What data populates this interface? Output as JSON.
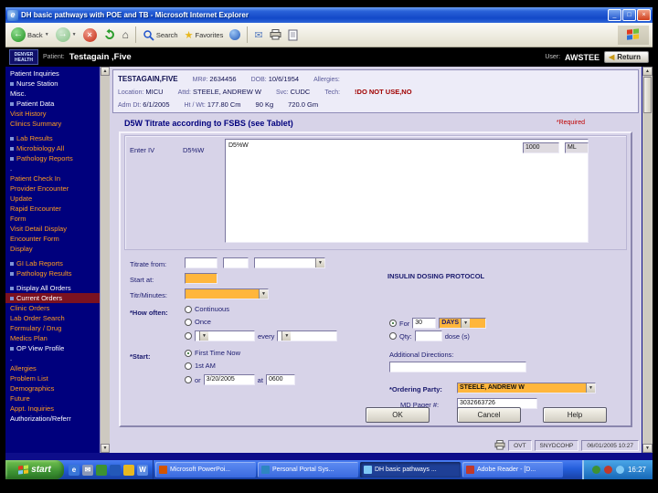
{
  "window": {
    "title": "DH basic pathways with POE and TB - Microsoft Internet Explorer"
  },
  "icons": {
    "ie_logo": "e",
    "back_arrow": "←",
    "forward_arrow": "→",
    "stop_x": "×",
    "home": "⌂",
    "favorites_star": "★",
    "mail_envelope": "✉",
    "dropdown_arrow": "▼",
    "scroll_up": "▲",
    "scroll_down": "▼",
    "return_arrow": "◀",
    "minimize": "_",
    "maximize": "□",
    "close_x": "×"
  },
  "toolbar": {
    "back_label": "Back",
    "search_label": "Search",
    "favorites_label": "Favorites"
  },
  "header": {
    "logo_line1": "DENVER",
    "logo_line2": "HEALTH",
    "patient_label": "Patient:",
    "patient_name": "Testagain ,Five",
    "user_label": "User:",
    "user_name": "AWSTEE",
    "return_label": "Return"
  },
  "sidebar": {
    "items": [
      {
        "label": "Patient Inquiries",
        "color": "white"
      },
      {
        "label": "Nurse Station",
        "color": "white",
        "bullet": true
      },
      {
        "label": "Misc.",
        "color": "white"
      },
      {
        "label": "Patient Data",
        "color": "white",
        "bullet": true
      },
      {
        "label": "Visit History",
        "color": "orange"
      },
      {
        "label": "Clinics Summary",
        "color": "orange"
      },
      {
        "spacer": true
      },
      {
        "label": "Lab Results",
        "color": "orange",
        "bullet": true
      },
      {
        "label": "Microbiology All",
        "color": "orange",
        "bullet": true
      },
      {
        "label": "Pathology Reports",
        "color": "orange",
        "bullet": true
      },
      {
        "label": ".",
        "color": "white"
      },
      {
        "label": "Patient Check In",
        "color": "orange"
      },
      {
        "label": "Provider Encounter",
        "color": "orange"
      },
      {
        "label": "Update",
        "color": "orange"
      },
      {
        "label": "Rapid Encounter",
        "color": "orange"
      },
      {
        "label": "Form",
        "color": "orange"
      },
      {
        "label": "Visit Detail Display",
        "color": "orange"
      },
      {
        "label": "Encounter Form",
        "color": "orange"
      },
      {
        "label": "Display",
        "color": "orange"
      },
      {
        "spacer": true
      },
      {
        "label": "GI Lab Reports",
        "color": "orange",
        "bullet": true
      },
      {
        "label": "Pathology Results",
        "color": "orange",
        "bullet": true
      },
      {
        "spacer": true
      },
      {
        "label": "Display All Orders",
        "color": "white",
        "bullet": true
      },
      {
        "label": "Current Orders",
        "color": "white",
        "bullet": true,
        "selected": true
      },
      {
        "label": "Clinic Orders",
        "color": "orange"
      },
      {
        "label": "Lab Order Search",
        "color": "orange"
      },
      {
        "label": "Formulary / Drug",
        "color": "orange"
      },
      {
        "label": "Medics Plan",
        "color": "orange"
      },
      {
        "label": "OP View Profile",
        "color": "white",
        "bullet": true
      },
      {
        "label": ".",
        "color": "white"
      },
      {
        "label": "Allergies",
        "color": "orange"
      },
      {
        "label": "Problem List",
        "color": "orange"
      },
      {
        "label": "Demographics",
        "color": "orange"
      },
      {
        "label": "Future",
        "color": "orange"
      },
      {
        "label": "Appt. Inquiries",
        "color": "orange"
      },
      {
        "label": "Authorization/Referr",
        "color": "white"
      }
    ]
  },
  "patient_banner": {
    "rows": [
      {
        "fields": [
          {
            "value": "TESTAGAIN,FIVE",
            "bold": true
          },
          {
            "label": "MR#:",
            "value": "2634456"
          },
          {
            "label": "DOB:",
            "value": "10/6/1954"
          },
          {
            "label": "Allergies:",
            "value": ""
          }
        ]
      },
      {
        "fields": [
          {
            "label": "Location:",
            "value": "MICU"
          },
          {
            "label": "Attd:",
            "value": "STEELE, ANDREW W"
          },
          {
            "label": "Svc:",
            "value": "CUDC"
          },
          {
            "label": "Tech:",
            "value": ""
          },
          {
            "value": "!DO NOT USE,NO",
            "alert": true
          }
        ]
      },
      {
        "fields": [
          {
            "label": "Adm Dt:",
            "value": "6/1/2005"
          },
          {
            "label": "Ht / Wt:",
            "value": "177.80 Cm"
          },
          {
            "value": "90 Kg"
          },
          {
            "value": "720.0 Gm"
          }
        ]
      }
    ]
  },
  "order_form": {
    "title": "D5W  Titrate according to FSBS (see Tablet)",
    "required_note": "*Required",
    "enter_iv_label": "Enter IV",
    "iv_name": "D5%W",
    "iv_text": "D5%W",
    "volume_value": "1000",
    "volume_unit": "ML",
    "titrate_from_label": "Titrate from:",
    "titrate_from_value": "",
    "titrate_to_value": "",
    "titrate_unit_value": "",
    "start_at_label": "Start at:",
    "start_at_value": "",
    "titr_minutes_label": "Titr/Minutes:",
    "titr_minutes_value": "",
    "protocol_note": "INSULIN DOSING PROTOCOL",
    "how_often_label": "*How often:",
    "options": {
      "continuous_label": "Continuous",
      "once_label": "Once",
      "every_label": "every",
      "for_label": "For",
      "for_value": "30",
      "for_unit": "DAYS",
      "for_selected": true,
      "qty_label": "Qty:",
      "qty_value": "",
      "dose_label": "dose (s)"
    },
    "start_label": "*Start:",
    "start_options": {
      "first_time_now_label": "First Time Now",
      "first_time_now_selected": true,
      "first_am_label": "1st AM",
      "or_label": "or",
      "date_value": "3/20/2005",
      "at_label": "at",
      "time_value": "0600"
    },
    "additional_directions_label": "Additional Directions:",
    "additional_directions_value": "",
    "ordering_party_label": "*Ordering Party:",
    "ordering_party_value": "STEELE, ANDREW W",
    "md_pager_label": "MD Pager #:",
    "md_pager_value": "3032663726",
    "ok_label": "OK",
    "cancel_label": "Cancel",
    "help_label": "Help"
  },
  "status_bar": {
    "field1": "OVT",
    "field2": "SNYDCOHP",
    "timestamp": "06/01/2005 10:27"
  },
  "taskbar": {
    "start_label": "start",
    "tasks": [
      {
        "label": "Microsoft PowerPoi...",
        "icon_color": "#d35400",
        "active": false
      },
      {
        "label": "Personal Portal Sys...",
        "icon_color": "#2e86c1",
        "active": false
      },
      {
        "label": "DH basic pathways ...",
        "icon_color": "#7ec8f5",
        "active": true
      },
      {
        "label": "Adobe Reader - [D...",
        "icon_color": "#c0392b",
        "active": false
      }
    ],
    "clock": "16:27"
  }
}
